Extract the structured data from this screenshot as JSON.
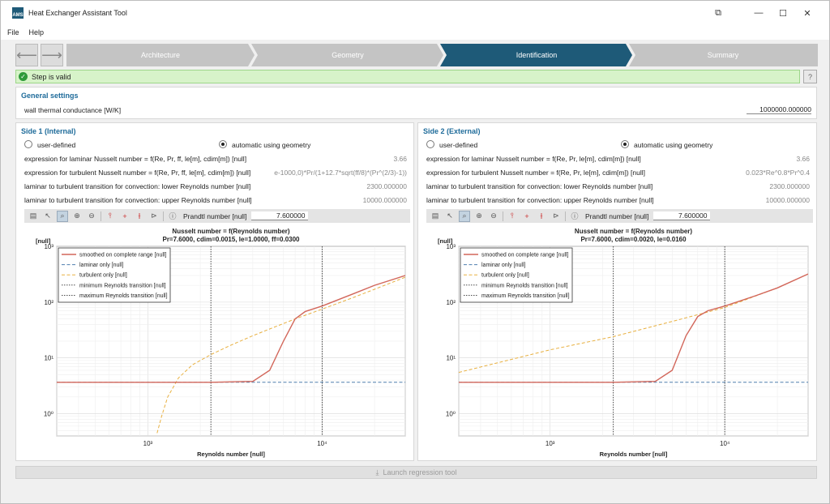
{
  "window": {
    "title": "Heat Exchanger Assistant Tool"
  },
  "menu": {
    "file": "File",
    "help": "Help"
  },
  "steps": [
    "Architecture",
    "Geometry",
    "Identification",
    "Summary"
  ],
  "status": {
    "text": "Step is valid",
    "help": "?"
  },
  "general": {
    "title": "General settings",
    "label": "wall thermal conductance [W/K]",
    "value": "1000000.000000"
  },
  "sides": [
    {
      "title": "Side 1 (Internal)",
      "radio_user": "user-defined",
      "radio_auto": "automatic using geometry",
      "rows": [
        {
          "label": "expression for laminar Nusselt number = f(Re, Pr, ff, le[m], cdim[m]) [null]",
          "value": "3.66"
        },
        {
          "label": "expression for turbulent Nusselt number = f(Re, Pr, ff, le[m], cdim[m]) [null]",
          "value": "e-1000,0)*Pr/(1+12.7*sqrt(ff/8)*(Pr^(2/3)-1))"
        },
        {
          "label": "laminar to turbulent transition for convection: lower Reynolds number [null]",
          "value": "2300.000000"
        },
        {
          "label": "laminar to turbulent transition for convection: upper Reynolds number [null]",
          "value": "10000.000000"
        }
      ],
      "prandtl_label": "Prandtl number [null]",
      "prandtl_value": "7.600000"
    },
    {
      "title": "Side 2 (External)",
      "radio_user": "user-defined",
      "radio_auto": "automatic using geometry",
      "rows": [
        {
          "label": "expression for laminar Nusselt number = f(Re, Pr, le[m], cdim[m]) [null]",
          "value": "3.66"
        },
        {
          "label": "expression for turbulent Nusselt number = f(Re, Pr, le[m], cdim[m]) [null]",
          "value": "0.023*Re^0.8*Pr^0.4"
        },
        {
          "label": "laminar to turbulent transition for convection: lower Reynolds number [null]",
          "value": "2300.000000"
        },
        {
          "label": "laminar to turbulent transition for convection: upper Reynolds number [null]",
          "value": "10000.000000"
        }
      ],
      "prandtl_label": "Prandtl number [null]",
      "prandtl_value": "7.600000"
    }
  ],
  "chart_data": [
    {
      "type": "line",
      "title": "Nusselt number = f(Reynolds number)",
      "subtitle": "Pr=7.6000, cdim=0.0015, le=1.0000, ff=0.0300",
      "xlabel": "Reynolds number [null]",
      "ylabel": "[null]",
      "xscale": "log",
      "yscale": "log",
      "xlim": [
        300,
        30000
      ],
      "ylim": [
        0.4,
        1000
      ],
      "xticks": [
        {
          "v": 1000,
          "label": "10³"
        },
        {
          "v": 10000,
          "label": "10⁴"
        }
      ],
      "yticks": [
        {
          "v": 1,
          "label": "10⁰"
        },
        {
          "v": 10,
          "label": "10¹"
        },
        {
          "v": 100,
          "label": "10²"
        },
        {
          "v": 1000,
          "label": "10³"
        }
      ],
      "grid": true,
      "legend_position": "top-left",
      "legend": [
        "smoothed on complete range [null]",
        "laminar only [null]",
        "turbulent only [null]",
        "minimum Reynolds transition [null]",
        "maximum Reynolds transition [null]"
      ],
      "series": [
        {
          "name": "smoothed on complete range [null]",
          "color": "#d2665a",
          "style": "solid",
          "x": [
            300,
            1000,
            2300,
            4000,
            5000,
            6000,
            7000,
            8000,
            10000,
            15000,
            20000,
            30000
          ],
          "y": [
            3.66,
            3.66,
            3.66,
            3.8,
            6,
            20,
            50,
            68,
            85,
            140,
            200,
            300
          ]
        },
        {
          "name": "laminar only [null]",
          "color": "#4f7fae",
          "style": "dashed",
          "x": [
            300,
            30000
          ],
          "y": [
            3.66,
            3.66
          ]
        },
        {
          "name": "turbulent only [null]",
          "color": "#e8b040",
          "style": "dashed",
          "x": [
            1130,
            1200,
            1300,
            1500,
            1800,
            2300,
            3000,
            4000,
            5000,
            7000,
            10000,
            15000,
            20000,
            30000
          ],
          "y": [
            0.45,
            0.9,
            2,
            4.4,
            7.5,
            11.5,
            17,
            25,
            33,
            50,
            75,
            120,
            170,
            280
          ]
        }
      ],
      "vlines": [
        {
          "name": "minimum Reynolds transition [null]",
          "x": 2300
        },
        {
          "name": "maximum Reynolds transition [null]",
          "x": 10000
        }
      ]
    },
    {
      "type": "line",
      "title": "Nusselt number = f(Reynolds number)",
      "subtitle": "Pr=7.6000, cdim=0.0020, le=0.0160",
      "xlabel": "Reynolds number [null]",
      "ylabel": "[null]",
      "xscale": "log",
      "yscale": "log",
      "xlim": [
        300,
        30000
      ],
      "ylim": [
        0.4,
        1000
      ],
      "xticks": [
        {
          "v": 1000,
          "label": "10³"
        },
        {
          "v": 10000,
          "label": "10⁴"
        }
      ],
      "yticks": [
        {
          "v": 1,
          "label": "10⁰"
        },
        {
          "v": 10,
          "label": "10¹"
        },
        {
          "v": 100,
          "label": "10²"
        },
        {
          "v": 1000,
          "label": "10³"
        }
      ],
      "grid": true,
      "legend_position": "top-left",
      "legend": [
        "smoothed on complete range [null]",
        "laminar only [null]",
        "turbulent only [null]",
        "minimum Reynolds transition [null]",
        "maximum Reynolds transition [null]"
      ],
      "series": [
        {
          "name": "smoothed on complete range [null]",
          "color": "#d2665a",
          "style": "solid",
          "x": [
            300,
            1000,
            2300,
            4000,
            5000,
            6000,
            7000,
            8000,
            10000,
            15000,
            20000,
            30000
          ],
          "y": [
            3.66,
            3.66,
            3.66,
            3.8,
            6,
            25,
            55,
            70,
            85,
            130,
            180,
            320
          ]
        },
        {
          "name": "laminar only [null]",
          "color": "#4f7fae",
          "style": "dashed",
          "x": [
            300,
            30000
          ],
          "y": [
            3.66,
            3.66
          ]
        },
        {
          "name": "turbulent only [null]",
          "color": "#e8b040",
          "style": "dashed",
          "x": [
            300,
            1000,
            2300,
            5000,
            10000,
            20000,
            30000
          ],
          "y": [
            5.5,
            14,
            24,
            45,
            80,
            180,
            320
          ]
        }
      ],
      "vlines": [
        {
          "name": "minimum Reynolds transition [null]",
          "x": 2300
        },
        {
          "name": "maximum Reynolds transition [null]",
          "x": 10000
        }
      ]
    }
  ],
  "bottom": {
    "button": "Launch regression tool"
  },
  "colors": {
    "active_step": "#1e5a78",
    "inactive_step": "#c4c4c4",
    "accent": "#1e6b9a"
  }
}
